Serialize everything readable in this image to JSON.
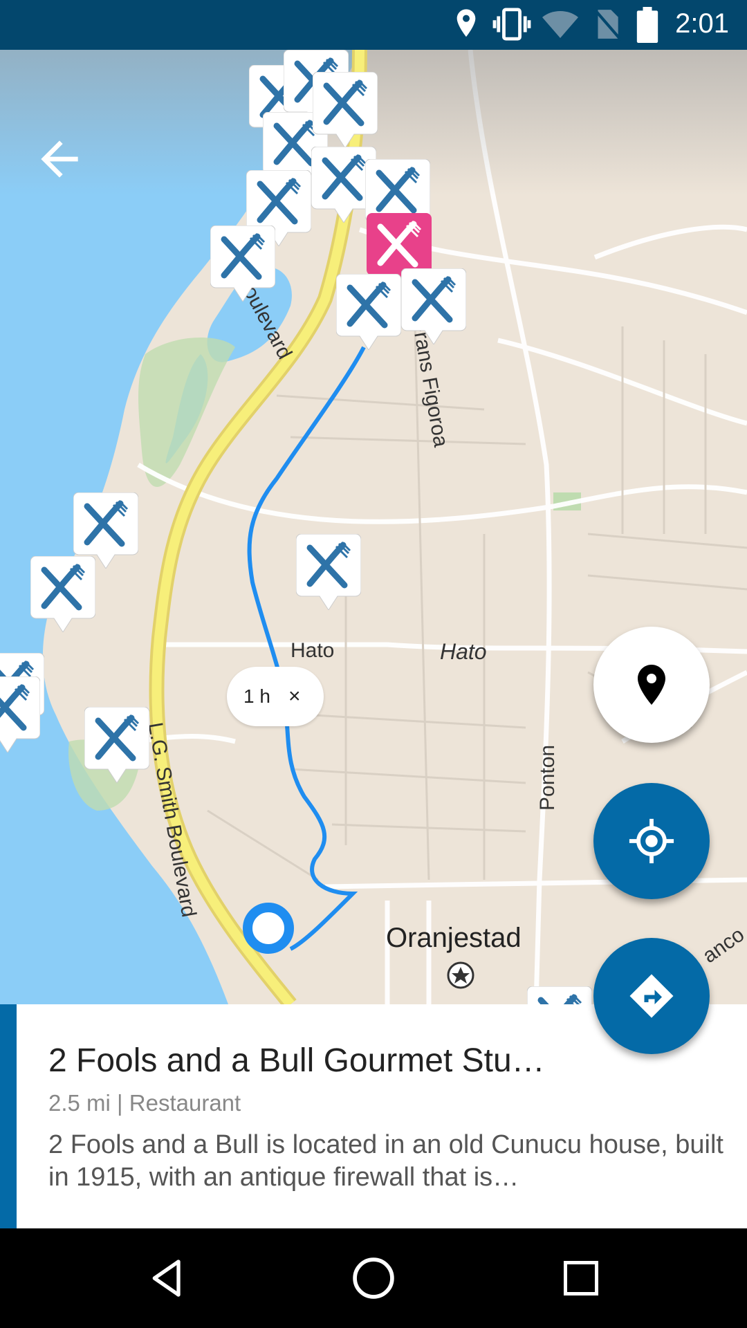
{
  "status_bar": {
    "time": "2:01",
    "icons": [
      "location-icon",
      "vibrate-icon",
      "wifi-icon",
      "no-sim-icon",
      "battery-icon"
    ]
  },
  "map": {
    "street_labels": {
      "caya_frans_figoroa": "Caya Frans Figoroa",
      "boulevard_top": "in Boulevard",
      "hato_chip": "Hato",
      "hato": "Hato",
      "ponton": "Ponton",
      "lg_smith": "L.G. Smith Boulevard",
      "oranjestad": "Oranjestad",
      "blanco": "anco"
    },
    "route_chip": {
      "duration": "1 h",
      "close": "×"
    },
    "colors": {
      "water": "#8bcdf7",
      "land": "#ede4d8",
      "route": "#1f8df0",
      "highway": "#f5e96b",
      "pin": "#2e73a8",
      "pin_selected": "#e8418a"
    }
  },
  "fabs": {
    "place_icon": "place-icon",
    "my_location_icon": "my-location-icon",
    "directions_icon": "directions-icon"
  },
  "place": {
    "title": "2 Fools and a Bull Gourmet Stu…",
    "meta": "2.5 mi | Restaurant",
    "description": "2 Fools and a Bull is located in an old Cunucu house, built in 1915, with an antique firewall that is…"
  },
  "nav": {
    "back": "back-icon",
    "home": "home-icon",
    "recents": "recents-icon"
  }
}
